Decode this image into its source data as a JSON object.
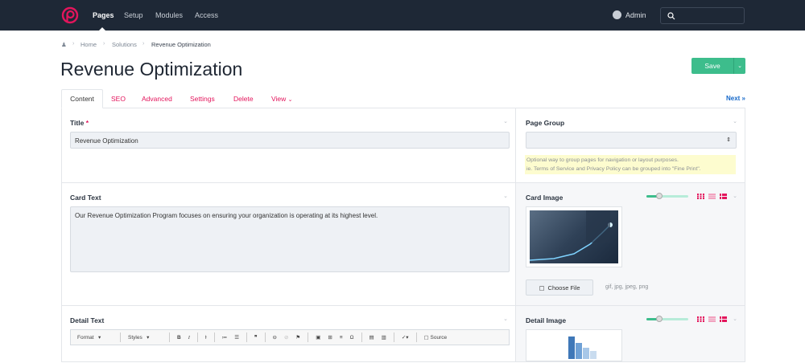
{
  "nav": {
    "items": [
      "Pages",
      "Setup",
      "Modules",
      "Access"
    ],
    "user": "Admin"
  },
  "breadcrumb": [
    "Home",
    "Solutions",
    "Revenue Optimization"
  ],
  "page": {
    "title": "Revenue Optimization",
    "save": "Save",
    "next": "Next »"
  },
  "tabs": [
    "Content",
    "SEO",
    "Advanced",
    "Settings",
    "Delete",
    "View"
  ],
  "fields": {
    "title": {
      "label": "Title",
      "required": "*",
      "value": "Revenue Optimization"
    },
    "page_group": {
      "label": "Page Group",
      "value": "",
      "help1": "Optional way to group pages for navigation or layout purposes.",
      "help2": "ie. Terms of Service and Privacy Policy can be grouped into \"Fine Print\"."
    },
    "card_text": {
      "label": "Card Text",
      "value": "Our Revenue Optimization Program focuses on ensuring your organization is operating at its highest level."
    },
    "card_image": {
      "label": "Card Image",
      "choose": "Choose File",
      "types": "gif, jpg, jpeg, png",
      "size": 0.3
    },
    "detail_text": {
      "label": "Detail Text",
      "toolbar": {
        "format": "Format",
        "styles": "Styles",
        "source": "Source"
      }
    },
    "detail_image": {
      "label": "Detail Image",
      "size": 0.3
    }
  },
  "colors": {
    "accent": "#e3155c",
    "save": "#3dbd8c",
    "nav": "#1e2836",
    "link": "#1467c9"
  }
}
